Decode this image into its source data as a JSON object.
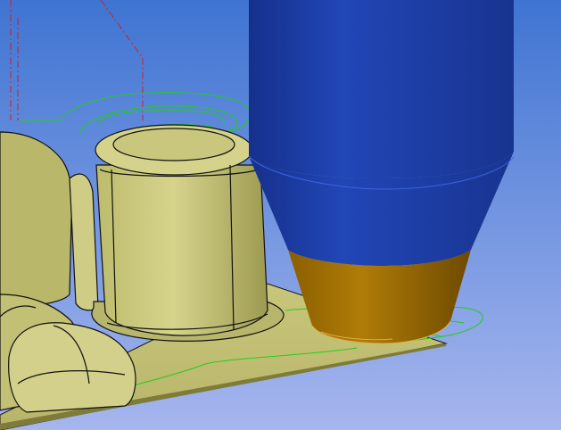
{
  "viewport": {
    "background_top": "#3f74d2",
    "background_bottom": "#a6b6ee"
  },
  "colors": {
    "part_fill": "#c9c77a",
    "part_shade": "#8f8c45",
    "part_edge": "#111111",
    "toolpath": "#22cc22",
    "rapid_move": "#cc2222",
    "tool_holder": "#1f3a9e",
    "tool_holder_edge": "#3b63e6",
    "tool_tip": "#9a6c00",
    "tool_tip_edge": "#e0b040"
  }
}
